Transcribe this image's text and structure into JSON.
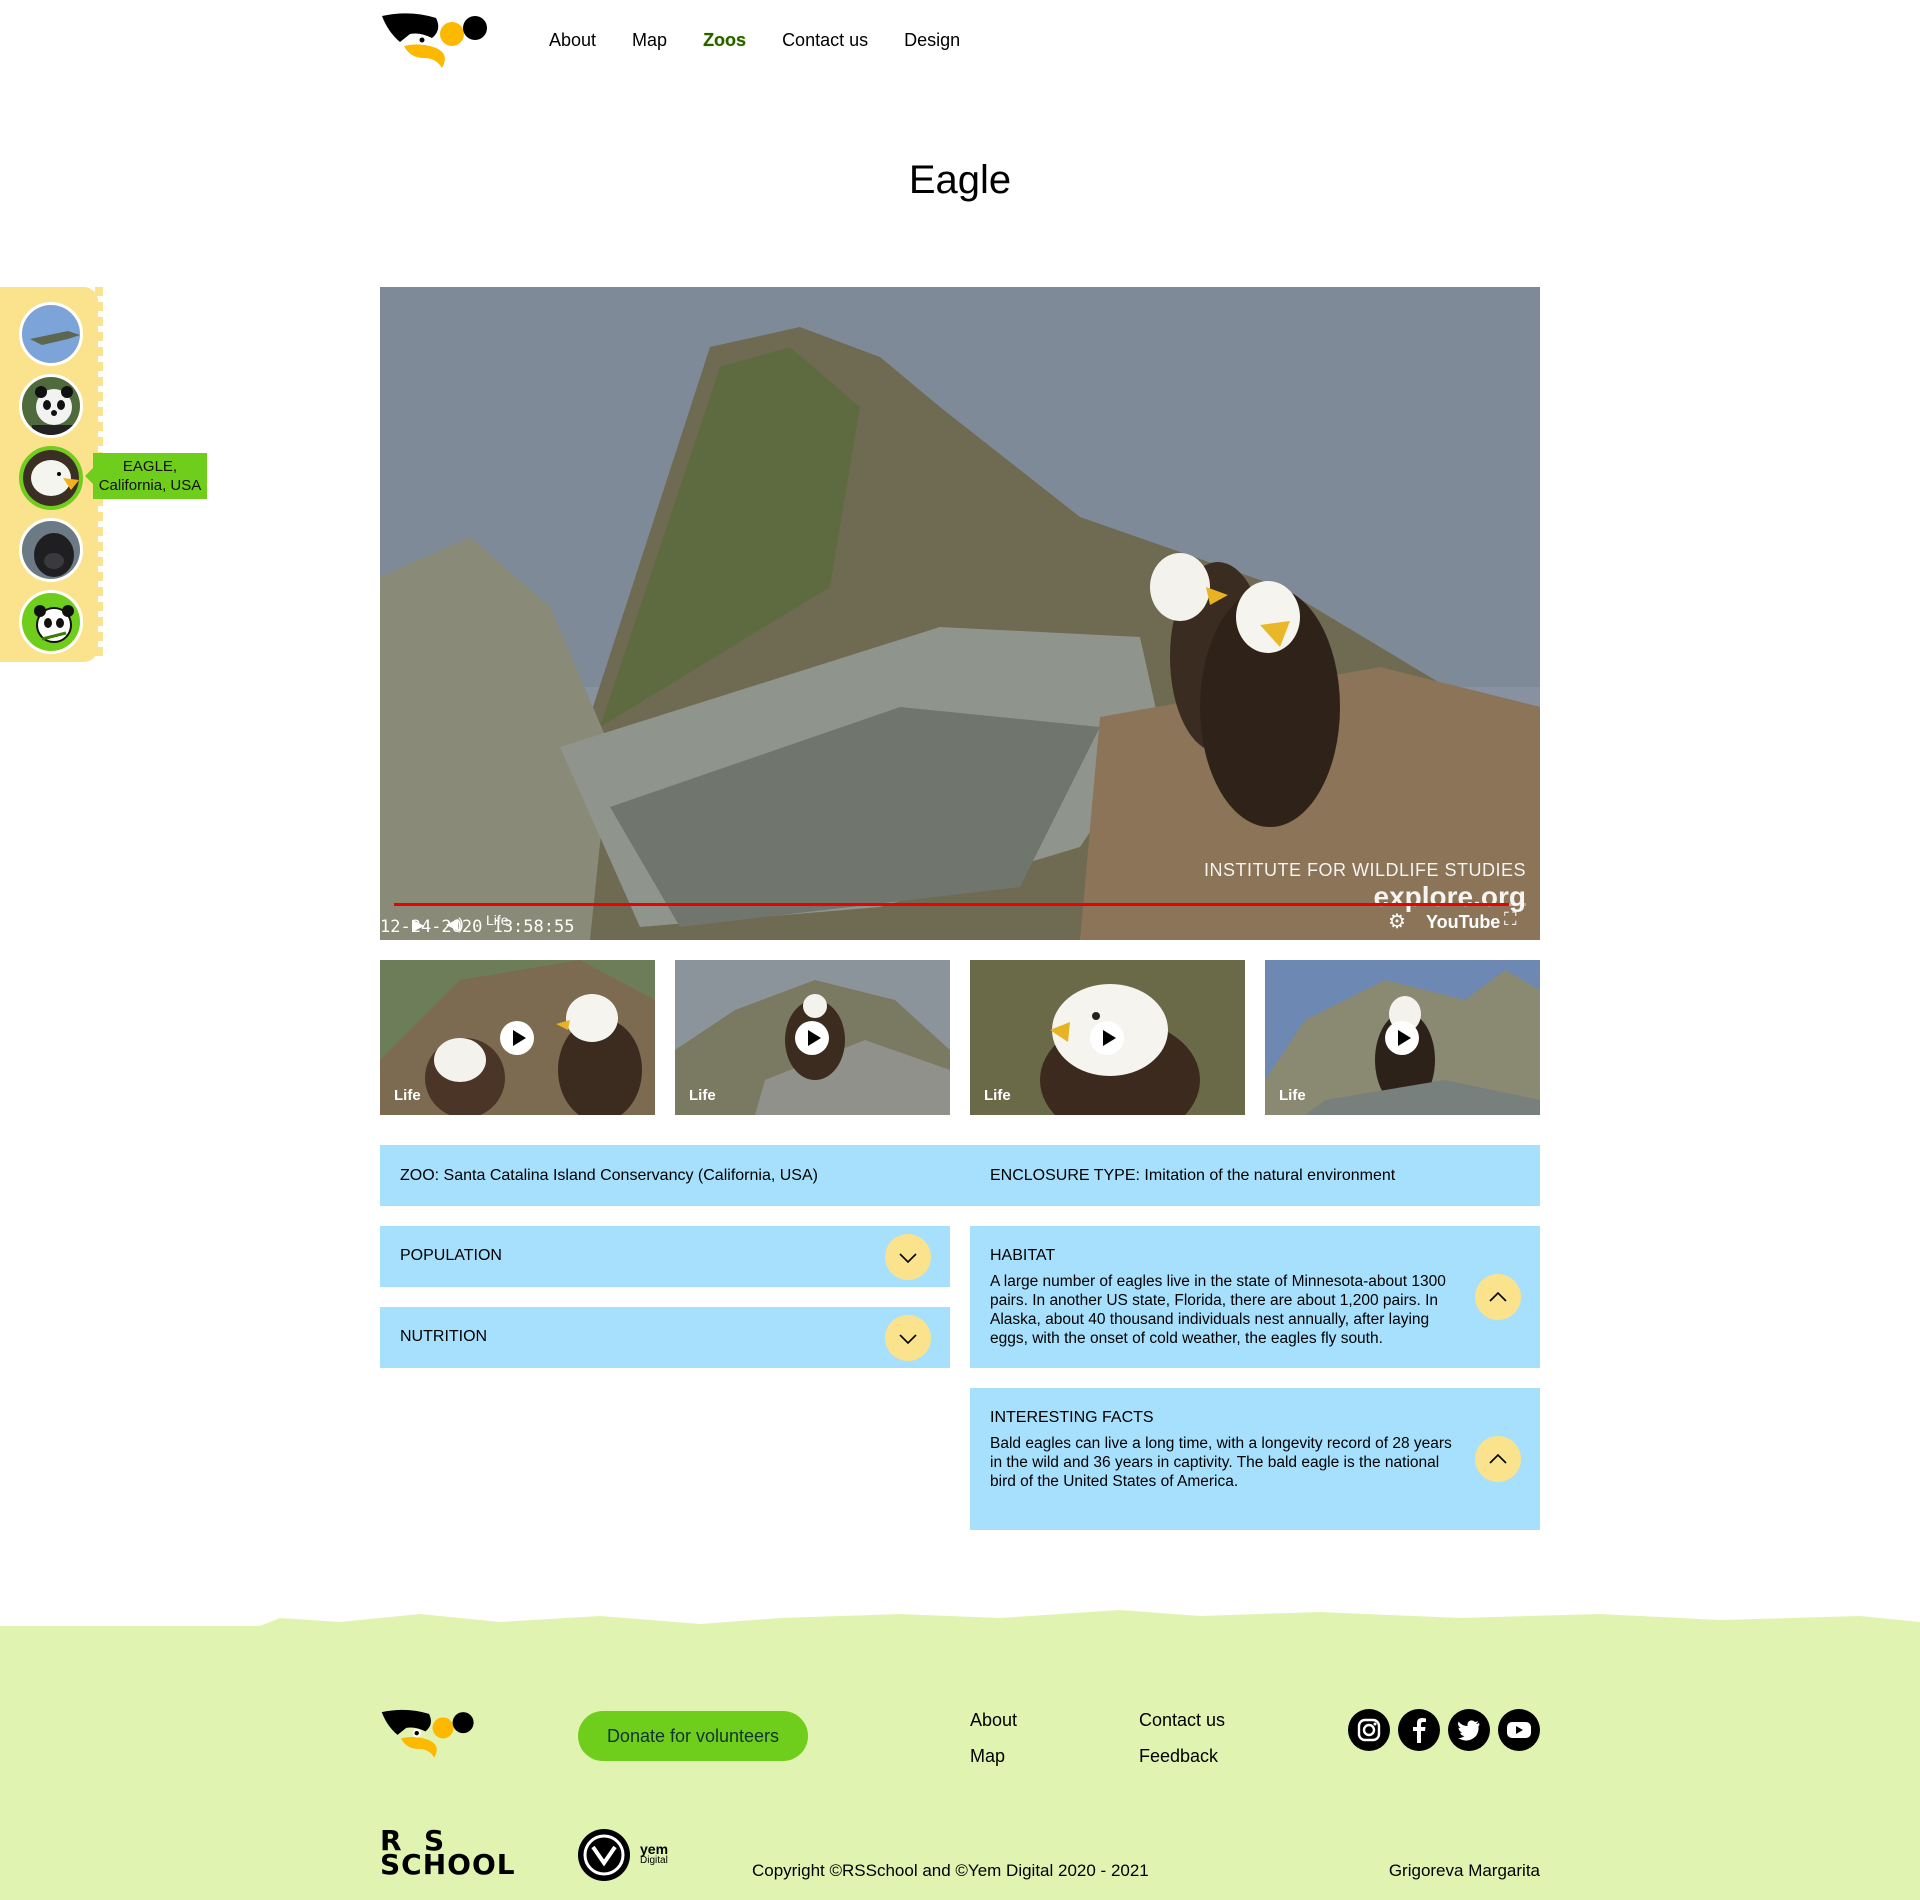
{
  "header": {
    "nav": [
      {
        "label": "About",
        "active": false
      },
      {
        "label": "Map",
        "active": false
      },
      {
        "label": "Zoos",
        "active": true
      },
      {
        "label": "Contact us",
        "active": false
      },
      {
        "label": "Design",
        "active": false
      }
    ]
  },
  "page_title": "Eagle",
  "side_nav": {
    "items": [
      "alligator-avatar",
      "panda-avatar",
      "eagle-avatar",
      "gorilla-avatar",
      "panda-cartoon-avatar"
    ],
    "active_index": 2,
    "tooltip_line1": "EAGLE,",
    "tooltip_line2": "California, USA"
  },
  "video": {
    "watermark_org": "INSTITUTE FOR WILDLIFE STUDIES",
    "watermark_site": "explore.org",
    "timestamp": "12-24-2020  13:58:55",
    "live_label": "Life",
    "youtube_label": "YouTube",
    "progress": 0.985
  },
  "thumbnails": [
    {
      "label": "Life"
    },
    {
      "label": "Life"
    },
    {
      "label": "Life"
    },
    {
      "label": "Life"
    }
  ],
  "info": {
    "zoo": "ZOO: Santa Catalina Island Conservancy (California, USA)",
    "enclosure": "ENCLOSURE TYPE: Imitation of the natural environment",
    "population_title": "POPULATION",
    "nutrition_title": "NUTRITION",
    "habitat_title": "HABITAT",
    "habitat_text": "A large number of eagles live in the state of Minnesota-about 1300 pairs. In another US state, Florida, there are about 1,200 pairs. In Alaska, about 40 thousand individuals nest annually, after laying eggs, with the onset of cold weather, the eagles fly south.",
    "facts_title": "INTERESTING FACTS",
    "facts_text": "Bald eagles can live a long time, with a longevity record of 28 years in the wild and 36 years in captivity. The bald eagle is the national bird of the United States of America."
  },
  "footer": {
    "donate_label": "Donate for volunteers",
    "links": {
      "about": "About",
      "map": "Map",
      "contact": "Contact us",
      "feedback": "Feedback"
    },
    "social": [
      "instagram-icon",
      "facebook-icon",
      "twitter-icon",
      "youtube-icon"
    ],
    "rs_line1": "R  S",
    "rs_line2": "SCHOOL",
    "yem_line1": "yem",
    "yem_line2": "Digital",
    "copyright": "Copyright ©RSSchool and ©Yem Digital 2020 - 2021",
    "author": "Grigoreva Margarita"
  },
  "colors": {
    "accent_green": "#6fcd1b",
    "panel_blue": "#a6e0fd",
    "yellow": "#fbe38e",
    "footer_green": "#e0f3b1"
  }
}
